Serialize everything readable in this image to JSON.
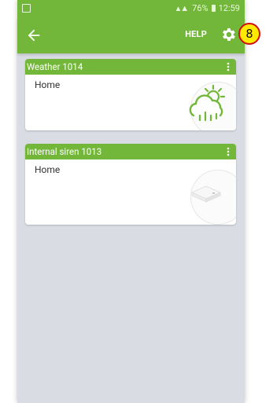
{
  "status": {
    "battery_pct": "76%",
    "time": "12:59"
  },
  "toolbar": {
    "help_label": "HELP"
  },
  "annotation": {
    "badge_number": "8"
  },
  "devices": [
    {
      "name": "Weather 1014",
      "room": "Home",
      "icon": "weather-icon"
    },
    {
      "name": "Internal siren 1013",
      "room": "Home",
      "icon": "siren-icon"
    }
  ],
  "colors": {
    "accent": "#73b73a",
    "background": "#d9dde3",
    "card": "#ffffff"
  }
}
